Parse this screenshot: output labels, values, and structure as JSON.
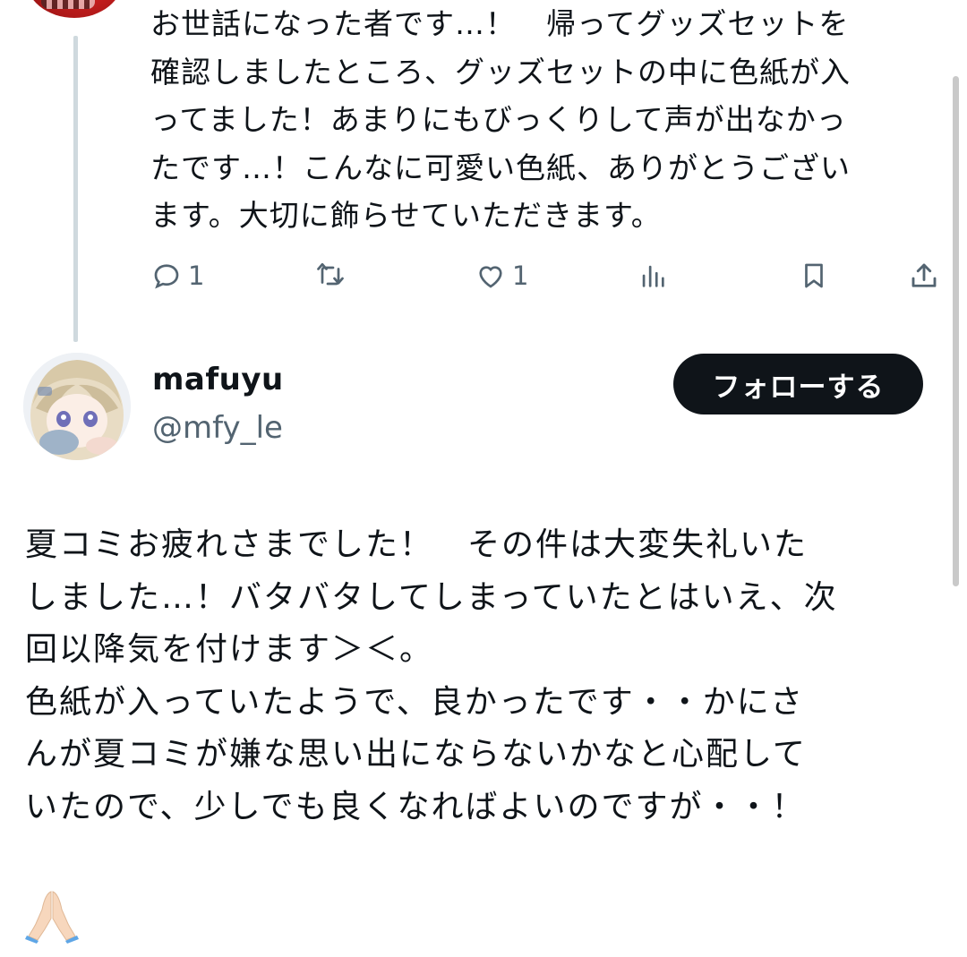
{
  "parent_reply": {
    "avatar_icon": "user-avatar-red",
    "text": "お世話になった者です…！　帰ってグッズセットを\n確認しましたところ、グッズセットの中に色紙が入\nってました！あまりにもびっくりして声が出なかっ\nたです…！こんなに可愛い色紙、ありがとうござい\nます。大切に飾らせていただきます。",
    "actions": {
      "reply_count": "1",
      "like_count": "1",
      "icons": [
        "reply-icon",
        "retweet-icon",
        "like-icon",
        "views-icon",
        "bookmark-icon",
        "share-icon"
      ]
    }
  },
  "reply": {
    "display_name": "mafuyu",
    "handle": "@mfy_le",
    "follow_label": "フォローする",
    "avatar_icon": "user-avatar-anime",
    "text": "夏コミお疲れさまでした！　その件は大変失礼いた\nしました…！バタバタしてしまっていたとはいえ、次\n回以降気を付けます＞＜。\n色紙が入っていたようで、良かったです・・かにさ\nんが夏コミが嫌な思い出にならないかなと心配して\nいたので、少しでも良くなればよいのですが・・！",
    "emoji": "🙏🏻",
    "emoji_icon": "folded-hands-icon"
  },
  "colors": {
    "text": "#0f1419",
    "muted": "#536471",
    "thread_line": "#cfd9de",
    "button_bg": "#0f1419",
    "button_text": "#ffffff"
  }
}
